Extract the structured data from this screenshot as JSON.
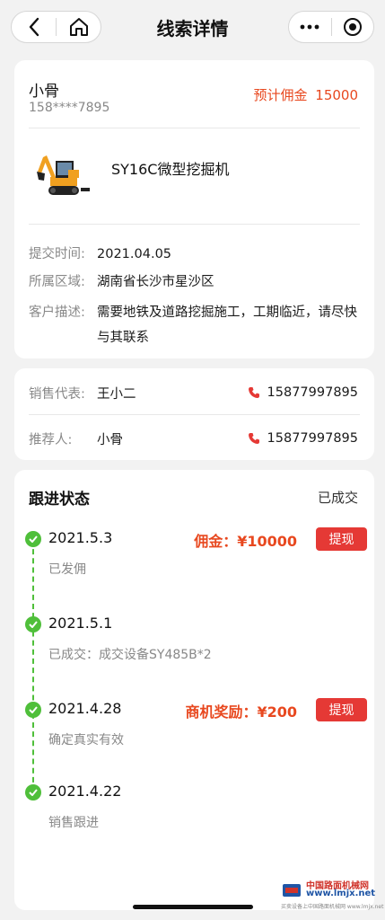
{
  "nav": {
    "title": "线索详情",
    "back_icon": "chevron-left-icon",
    "home_icon": "home-icon",
    "more_icon": "more-dots-icon",
    "close_icon": "target-circle-icon"
  },
  "lead": {
    "name": "小骨",
    "phone": "158****7895",
    "commission_label": "预计佣金",
    "commission_value": "15000",
    "product_name": "SY16C微型挖掘机",
    "details": [
      {
        "label": "提交时间:",
        "value": "2021.04.05"
      },
      {
        "label": "所属区域:",
        "value": "湖南省长沙市星沙区"
      },
      {
        "label": "客户描述:",
        "value": "需要地铁及道路挖掘施工，工期临近，请尽快与其联系"
      }
    ]
  },
  "contacts": [
    {
      "label": "销售代表:",
      "name": "王小二",
      "phone": "15877997895"
    },
    {
      "label": "推荐人:",
      "name": "小骨",
      "phone": "15877997895"
    }
  ],
  "followup": {
    "title": "跟进状态",
    "status": "已成交",
    "items": [
      {
        "date": "2021.5.3",
        "desc": "已发佣",
        "amount": "佣金：¥10000",
        "button": "提现"
      },
      {
        "date": "2021.5.1",
        "desc": "已成交：成交设备SY485B*2",
        "amount": "",
        "button": ""
      },
      {
        "date": "2021.4.28",
        "desc": "确定真实有效",
        "amount": "商机奖励：¥200",
        "button": "提现"
      },
      {
        "date": "2021.4.22",
        "desc": "销售跟进",
        "amount": "",
        "button": ""
      }
    ]
  },
  "watermark": {
    "line1": "中国路面机械网",
    "line2": "www.lmjx.net",
    "line3": "买卖设备上中国路面机械网 www.lmjx.net"
  },
  "colors": {
    "accent": "#e8481f",
    "button": "#e53935",
    "timeline": "#4fbf3a"
  }
}
